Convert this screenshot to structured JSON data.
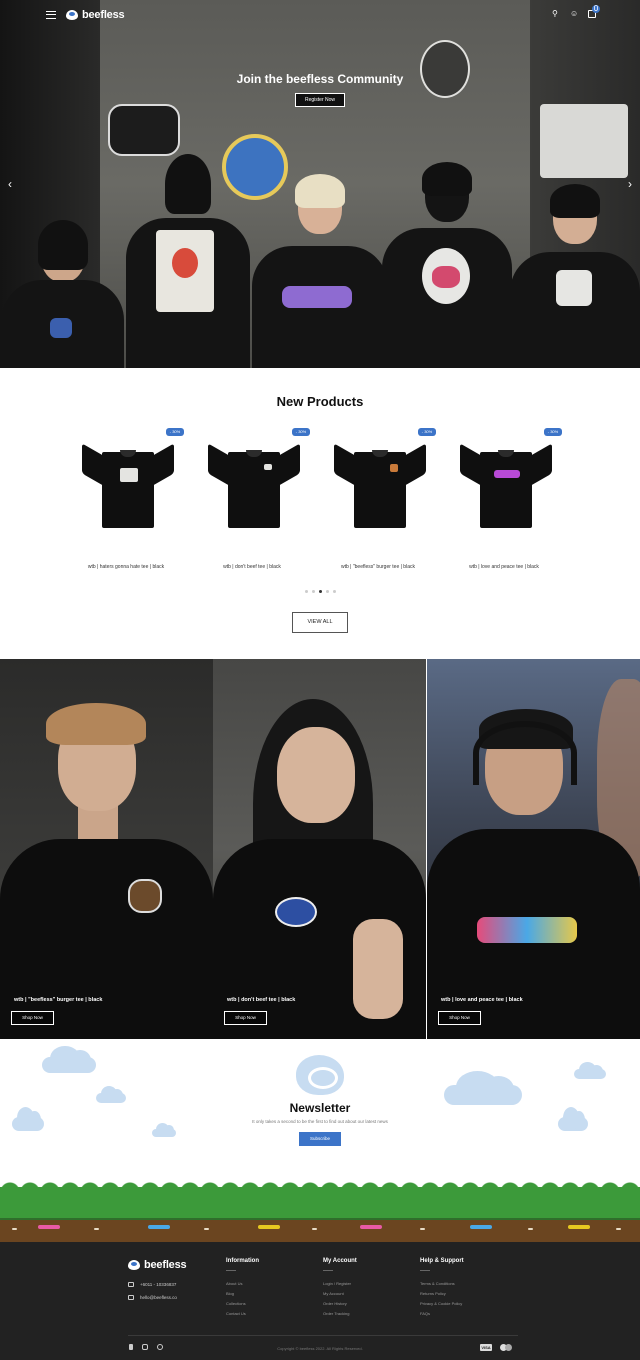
{
  "header": {
    "logo_text": "beefless",
    "cart_count": "0",
    "icons": [
      "menu-icon",
      "search-icon",
      "user-icon",
      "cart-icon"
    ]
  },
  "hero": {
    "title": "Join the beefless Community",
    "button": "Register Now",
    "prev_arrow": "‹",
    "next_arrow": "›"
  },
  "new_products": {
    "title": "New Products",
    "items": [
      {
        "name": "wtb | haters gonna hate tee | black",
        "badge": "- 30%"
      },
      {
        "name": "wtb | don't beef tee | black",
        "badge": "- 30%"
      },
      {
        "name": "wtb | \"beefless\" burger tee | black",
        "badge": "- 30%"
      },
      {
        "name": "wtb | love and peace tee | black",
        "badge": "- 30%"
      }
    ],
    "view_all": "VIEW ALL",
    "active_dot": 2,
    "dot_count": 5
  },
  "lookbook": [
    {
      "name": "wtb | \"beefless\" burger tee | black",
      "button": "Shop Now"
    },
    {
      "name": "wtb | don't beef tee | black",
      "button": "Shop Now"
    },
    {
      "name": "wtb | love and peace tee | black",
      "button": "Shop Now"
    }
  ],
  "newsletter": {
    "title": "Newsletter",
    "subtitle": "It only takes a second to be the first to find out about our latest news",
    "button": "Subscribe"
  },
  "footer": {
    "logo_text": "beefless",
    "phone": "+6011 - 10336837",
    "email": "hello@beefless.co",
    "columns": [
      {
        "title": "Information",
        "links": [
          "About Us",
          "Blog",
          "Collections",
          "Contact Us"
        ]
      },
      {
        "title": "My Account",
        "links": [
          "Login / Register",
          "My Account",
          "Order History",
          "Order Tracking"
        ]
      },
      {
        "title": "Help & Support",
        "links": [
          "Terms & Conditions",
          "Returns Policy",
          "Privacy & Cookie Policy",
          "FAQs"
        ]
      }
    ],
    "copyright": "Copyright © beefless 2022. All Rights Reserved.",
    "payments": [
      "VISA",
      "MC"
    ],
    "social": [
      "facebook-icon",
      "instagram-icon",
      "whatsapp-icon"
    ]
  },
  "colors": {
    "accent": "#3c74c8",
    "footer_bg": "#222222",
    "grass": "#3c9a3a",
    "dirt": "#6b4520"
  }
}
